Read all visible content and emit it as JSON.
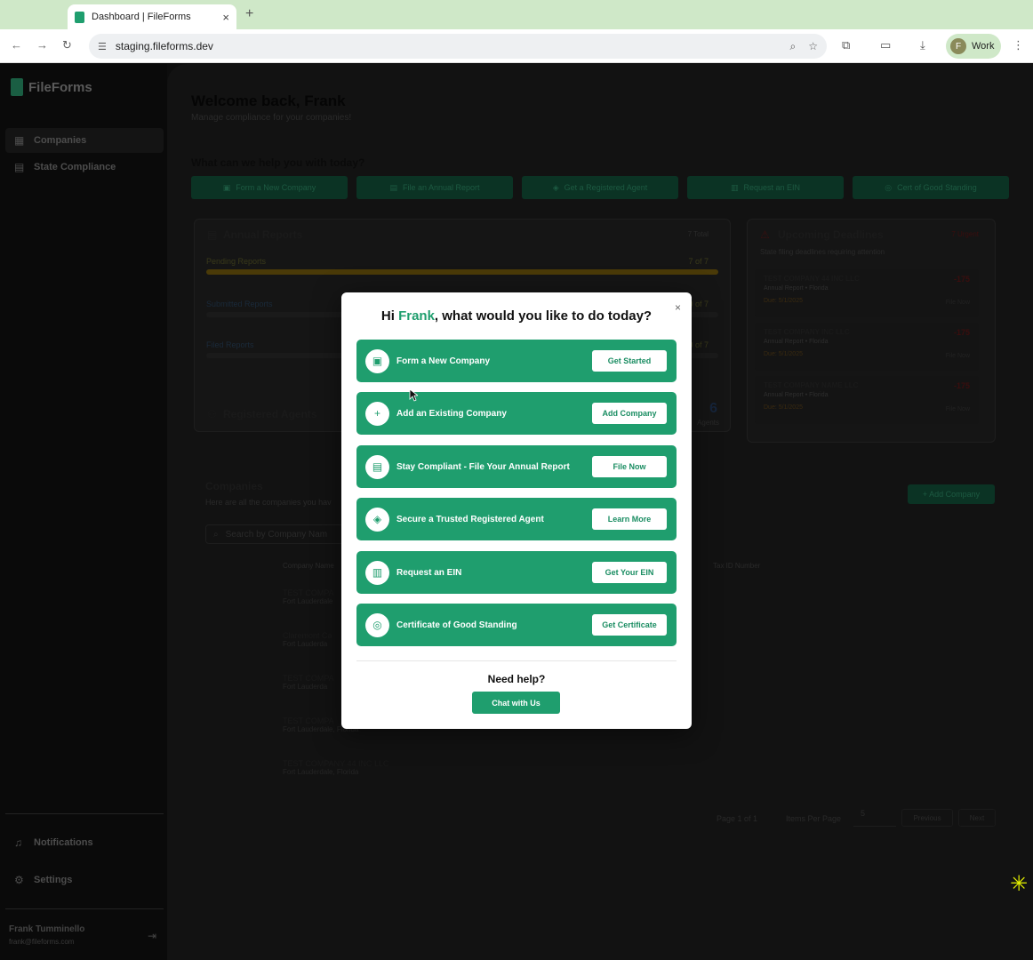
{
  "browser": {
    "tab_title": "Dashboard | FileForms",
    "tab_close": "×",
    "new_tab": "+",
    "url": "staging.fileforms.dev",
    "profile_initial": "F",
    "profile_label": "Work"
  },
  "sidebar": {
    "logo": "FileForms",
    "nav": [
      {
        "label": "Companies"
      },
      {
        "label": "State Compliance"
      }
    ],
    "bottom": [
      {
        "label": "Notifications"
      },
      {
        "label": "Settings"
      }
    ],
    "user_name": "Frank Tumminello",
    "user_email": "frank@fileforms.com"
  },
  "main": {
    "welcome": "Welcome back, Frank",
    "welcome_sub": "Manage compliance for your companies!",
    "help_question": "What can we help you with today?",
    "quick_actions": [
      {
        "label": "Form a New Company"
      },
      {
        "label": "File an Annual Report"
      },
      {
        "label": "Get a Registered Agent"
      },
      {
        "label": "Request an EIN"
      },
      {
        "label": "Cert of Good Standing"
      }
    ],
    "annual_reports": {
      "title": "Annual Reports",
      "total": "7 Total",
      "rows": [
        {
          "label": "Pending Reports",
          "count": "7 of 7",
          "fraction": 1.0
        },
        {
          "label": "Submitted Reports",
          "count": "0 of 7",
          "fraction": 0
        },
        {
          "label": "Filed Reports",
          "count": "0 of 7",
          "fraction": 0
        }
      ]
    },
    "registered_agents": {
      "title": "Registered Agents",
      "count": "6",
      "count_label": "Agents"
    },
    "deadlines": {
      "title": "Upcoming Deadlines",
      "badge": "7 Urgent",
      "subtitle": "State filing deadlines requiring attention",
      "items": [
        {
          "name": "TEST COMPANY 44 INC LLC",
          "sub": "Annual Report • Florida",
          "due": "Due: 5/1/2025",
          "days": "-175",
          "days_label": "days",
          "action": "File Now"
        },
        {
          "name": "TEST COMPANY INC LLC",
          "sub": "Annual Report • Florida",
          "due": "Due: 5/1/2025",
          "days": "-175",
          "days_label": "days",
          "action": "File Now"
        },
        {
          "name": "TEST COMPANY NAME LLC",
          "sub": "Annual Report • Florida",
          "due": "Due: 5/1/2025",
          "days": "-175",
          "days_label": "days",
          "action": "File Now"
        }
      ]
    },
    "companies": {
      "title": "Companies",
      "subtitle": "Here are all the companies you hav",
      "add_button": "+ Add Company",
      "search_placeholder": "Search by Company Nam",
      "col_name": "Company Name",
      "col_tax": "Tax ID Number",
      "rows": [
        {
          "name": "TEST COMPA",
          "city": "Fort Lauderdale"
        },
        {
          "name": "Claremont Ca",
          "city": "Fort Lauderda"
        },
        {
          "name": "TEST COMPA",
          "city": "Fort Lauderda"
        },
        {
          "name": "TEST COMPA",
          "city": "Fort Lauderdale, Florida"
        },
        {
          "name": "TEST COMPANY 44 INC LLC",
          "city": "Fort Lauderdale, Florida"
        }
      ],
      "pagination": {
        "page": "Page 1 of 1",
        "per_page_label": "Items Per Page",
        "per_page": "5",
        "prev": "Previous",
        "next": "Next"
      }
    }
  },
  "modal": {
    "greeting_pre": "Hi ",
    "greeting_name": "Frank",
    "greeting_post": ", what would you like to do today?",
    "close": "×",
    "options": [
      {
        "label": "Form a New Company",
        "button": "Get Started",
        "icon": "briefcase-icon"
      },
      {
        "label": "Add an Existing Company",
        "button": "Add Company",
        "icon": "plus-icon"
      },
      {
        "label": "Stay Compliant - File Your Annual Report",
        "button": "File Now",
        "icon": "document-icon"
      },
      {
        "label": "Secure a Trusted Registered Agent",
        "button": "Learn More",
        "icon": "shield-icon"
      },
      {
        "label": "Request an EIN",
        "button": "Get Your EIN",
        "icon": "bank-icon"
      },
      {
        "label": "Certificate of Good Standing",
        "button": "Get Certificate",
        "icon": "award-icon"
      }
    ],
    "need_help": "Need help?",
    "chat_button": "Chat with Us"
  },
  "colors": {
    "brand": "#1f9e6e",
    "tab_bar": "#cfe8c8"
  }
}
